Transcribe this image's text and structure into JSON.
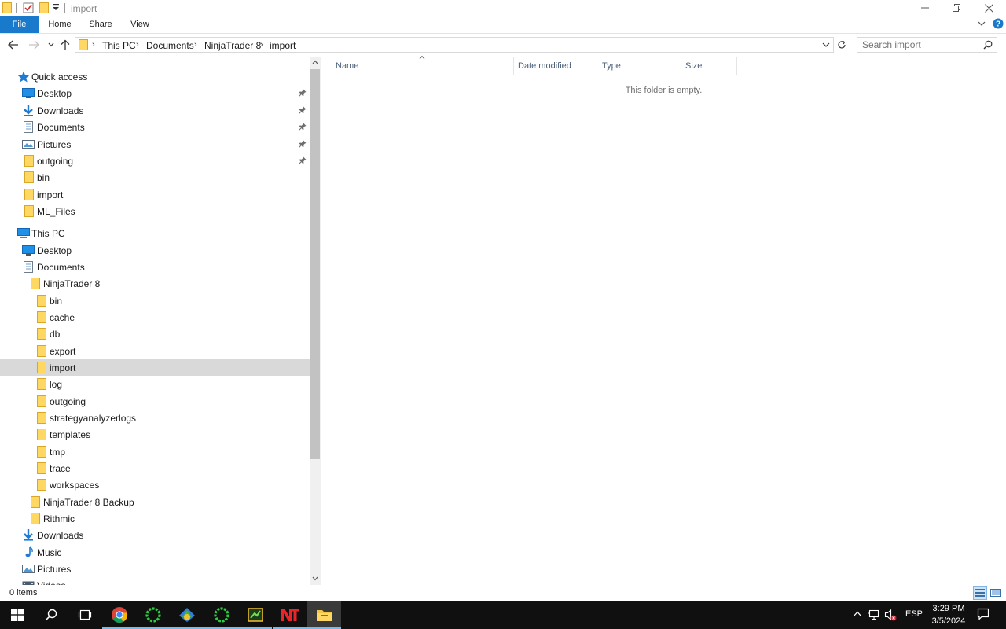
{
  "window": {
    "title": "import"
  },
  "ribbon": {
    "tabs": [
      "File",
      "Home",
      "Share",
      "View"
    ]
  },
  "address": {
    "crumbs": [
      "This PC",
      "Documents",
      "NinjaTrader 8",
      "import"
    ]
  },
  "search": {
    "placeholder": "Search import"
  },
  "nav": {
    "items": [
      {
        "label": "Quick access",
        "icon": "star-icon",
        "pinned": false
      },
      {
        "label": "Desktop",
        "icon": "desktop-icon",
        "pinned": true
      },
      {
        "label": "Downloads",
        "icon": "download-icon",
        "pinned": true
      },
      {
        "label": "Documents",
        "icon": "documents-icon",
        "pinned": true
      },
      {
        "label": "Pictures",
        "icon": "pictures-icon",
        "pinned": true
      },
      {
        "label": "outgoing",
        "icon": "folder-icon",
        "pinned": true
      },
      {
        "label": "bin",
        "icon": "folder-icon",
        "pinned": false
      },
      {
        "label": "import",
        "icon": "folder-icon",
        "pinned": false
      },
      {
        "label": "ML_Files",
        "icon": "folder-icon",
        "pinned": false
      },
      {
        "label": "This PC",
        "icon": "pc-icon",
        "pinned": false
      },
      {
        "label": "Desktop",
        "icon": "desktop-icon",
        "pinned": false
      },
      {
        "label": "Documents",
        "icon": "documents-icon",
        "pinned": false
      },
      {
        "label": "NinjaTrader 8",
        "icon": "folder-icon",
        "pinned": false
      },
      {
        "label": "bin",
        "icon": "folder-icon",
        "pinned": false
      },
      {
        "label": "cache",
        "icon": "folder-icon",
        "pinned": false
      },
      {
        "label": "db",
        "icon": "folder-icon",
        "pinned": false
      },
      {
        "label": "export",
        "icon": "folder-icon",
        "pinned": false
      },
      {
        "label": "import",
        "icon": "folder-icon",
        "pinned": false,
        "selected": true
      },
      {
        "label": "log",
        "icon": "folder-icon",
        "pinned": false
      },
      {
        "label": "outgoing",
        "icon": "folder-icon",
        "pinned": false
      },
      {
        "label": "strategyanalyzerlogs",
        "icon": "folder-icon",
        "pinned": false
      },
      {
        "label": "templates",
        "icon": "folder-icon",
        "pinned": false
      },
      {
        "label": "tmp",
        "icon": "folder-icon",
        "pinned": false
      },
      {
        "label": "trace",
        "icon": "folder-icon",
        "pinned": false
      },
      {
        "label": "workspaces",
        "icon": "folder-icon",
        "pinned": false
      },
      {
        "label": "NinjaTrader 8 Backup",
        "icon": "folder-icon",
        "pinned": false
      },
      {
        "label": "Rithmic",
        "icon": "folder-icon",
        "pinned": false
      },
      {
        "label": "Downloads",
        "icon": "download-icon",
        "pinned": false
      },
      {
        "label": "Music",
        "icon": "music-icon",
        "pinned": false
      },
      {
        "label": "Pictures",
        "icon": "pictures-icon",
        "pinned": false
      },
      {
        "label": "Videos",
        "icon": "videos-icon",
        "pinned": false
      }
    ]
  },
  "content": {
    "columns": [
      "Name",
      "Date modified",
      "Type",
      "Size"
    ],
    "empty_message": "This folder is empty."
  },
  "status": {
    "items_count": "0 items"
  },
  "taskbar": {
    "apps": [
      "windows-start-icon",
      "search-icon",
      "task-view-icon",
      "chrome-icon",
      "ninjatrader-ring-icon",
      "metatrader-icon",
      "ninjatrader-ring-icon",
      "trading-app-icon",
      "ninjatrader-logo-icon",
      "file-explorer-icon"
    ],
    "language": "ESP",
    "time": "3:29 PM",
    "date": "3/5/2024"
  },
  "colors": {
    "accent": "#1979ca",
    "folder": "#ffd863",
    "selection": "#d9d9d9",
    "taskbar": "#101010"
  }
}
